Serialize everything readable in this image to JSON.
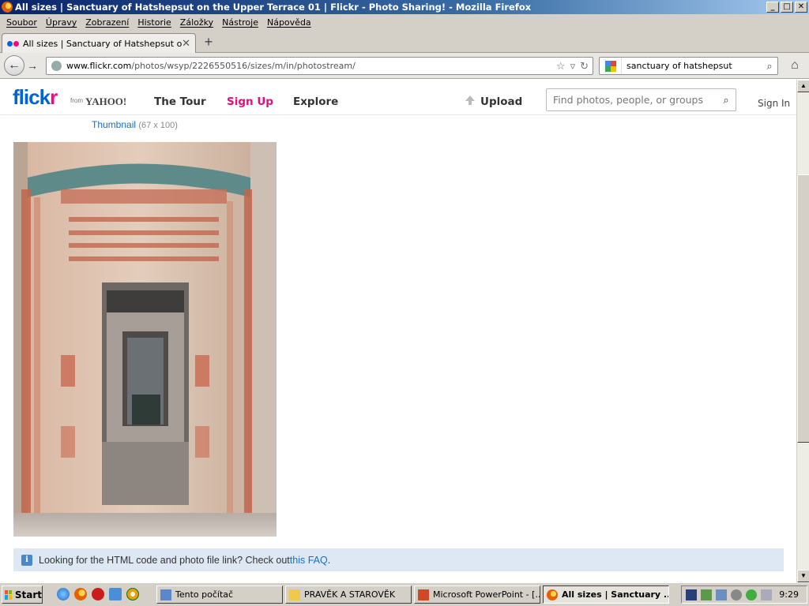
{
  "window": {
    "title": "All sizes | Sanctuary of Hatshepsut on the Upper Terrace 01 | Flickr - Photo Sharing! - Mozilla Firefox",
    "min": "_",
    "max": "□",
    "close": "✕"
  },
  "menu": [
    "Soubor",
    "Úpravy",
    "Zobrazení",
    "Historie",
    "Záložky",
    "Nástroje",
    "Nápověda"
  ],
  "tab": {
    "label": "All sizes | Sanctuary of Hatshepsut on the U...",
    "close": "✕",
    "new": "+"
  },
  "nav": {
    "back": "←",
    "forward": "→",
    "url_host": "www.flickr.com",
    "url_path": "/photos/wsyp/2226550516/sizes/m/in/photostream/",
    "star": "☆",
    "dropdown": "▿",
    "reload": "↻",
    "search_value": "sanctuary of hatshepsut",
    "search_go": "⌕",
    "home": "⌂"
  },
  "flickr": {
    "logo_fl": "flick",
    "logo_r": "r",
    "logo_from": "from",
    "logo_yahoo": "YAHOO!",
    "the_tour": "The Tour",
    "sign_up": "Sign Up",
    "explore": "Explore",
    "upload": "Upload",
    "search_placeholder": "Find photos, people, or groups",
    "search_icon": "⌕",
    "sign_in": "Sign In"
  },
  "page": {
    "thumbnail_link": "Thumbnail",
    "thumbnail_dims": "(67 x 100)",
    "faq_text": "Looking for the HTML code and photo file link? Check out ",
    "faq_link": "this FAQ",
    "faq_end": ".",
    "info": "i"
  },
  "scroll": {
    "up": "▲",
    "down": "▼"
  },
  "taskbar": {
    "start": "Start",
    "tasks": [
      "Tento počítač",
      "PRAVĚK A STAROVĚK",
      "Microsoft PowerPoint - [...",
      "All sizes | Sanctuary ..."
    ],
    "clock": "9:29"
  },
  "colors": {
    "flickr_blue": "#0063dc",
    "flickr_pink": "#ff0084",
    "link": "#1a6ebf",
    "faq_bg": "#dde8f4"
  }
}
